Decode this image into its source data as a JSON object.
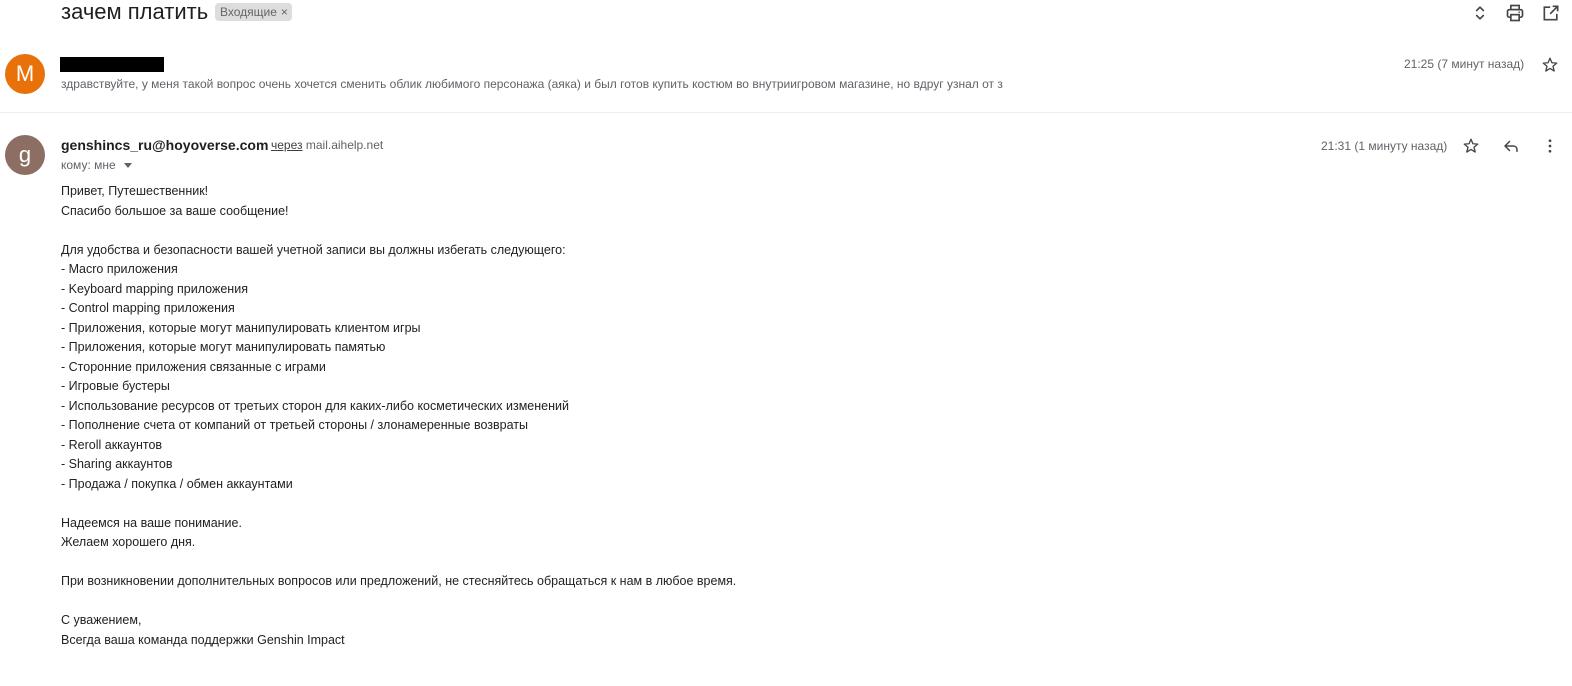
{
  "thread": {
    "subject": "зачем платить",
    "label": "Входящие",
    "label_remove": "×"
  },
  "toolbar_icons": {
    "expand": "unfold-icon",
    "print": "print-icon",
    "open_new": "open-in-new-window-icon"
  },
  "colors": {
    "avatar_m": "#e8710a",
    "avatar_g": "#8d6e63"
  },
  "messages": [
    {
      "avatar_letter": "M",
      "sender_redacted": true,
      "snippet": "здравствуйте, у меня такой вопрос очень хочется сменить облик любимого персонажа (аяка) и был готов купить костюм во внутриигровом магазине, но вдруг узнал от з",
      "time": "21:25 (7 минут назад)"
    },
    {
      "avatar_letter": "g",
      "sender_email": "genshincs_ru@hoyoverse.com",
      "via_label": "через",
      "via_domain": "mail.aihelp.net",
      "recipient": "кому: мне",
      "time": "21:31 (1 минуту назад)",
      "body_lines": [
        "Привет, Путешественник!",
        "Спасибо большое за ваше сообщение!",
        "",
        "Для удобства и безопасности вашей учетной записи вы должны избегать следующего:",
        "- Macro приложения",
        "- Keyboard mapping приложения",
        "- Control mapping приложения",
        "- Приложения, которые могут манипулировать клиентом игры",
        "- Приложения, которые могут манипулировать памятью",
        "- Сторонние приложения связанные с играми",
        "- Игровые бустеры",
        "- Использование ресурсов от третьих сторон для каких-либо косметических изменений",
        "- Пополнение счета от компаний от третьей стороны / злонамеренные возвраты",
        "- Reroll аккаунтов",
        "- Sharing аккаунтов",
        "- Продажа / покупка / обмен аккаунтами",
        "",
        "Надеемся на ваше понимание.",
        "Желаем хорошего дня.",
        "",
        "При возникновении дополнительных вопросов или предложений, не стесняйтесь обращаться к нам в любое время.",
        "",
        "С уважением,",
        "Всегда ваша команда поддержки Genshin Impact"
      ]
    }
  ]
}
